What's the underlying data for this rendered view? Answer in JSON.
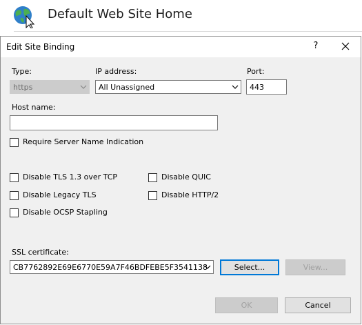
{
  "background": {
    "page_title": "Default Web Site Home"
  },
  "dialog": {
    "title": "Edit Site Binding",
    "help_label": "?",
    "close_label": "×",
    "type": {
      "label": "Type:",
      "value": "https"
    },
    "ip": {
      "label": "IP address:",
      "value": "All Unassigned"
    },
    "port": {
      "label": "Port:",
      "value": "443"
    },
    "host": {
      "label": "Host name:",
      "value": ""
    },
    "sni_label": "Require Server Name Indication",
    "options": {
      "disable_tls13": "Disable TLS 1.3 over TCP",
      "disable_legacy_tls": "Disable Legacy TLS",
      "disable_ocsp": "Disable OCSP Stapling",
      "disable_quic": "Disable QUIC",
      "disable_http2": "Disable HTTP/2"
    },
    "ssl": {
      "label": "SSL certificate:",
      "value": "CB7762892E69E6770E59A7F46BDFEBE5F3541138"
    },
    "buttons": {
      "select": "Select...",
      "view": "View...",
      "ok": "OK",
      "cancel": "Cancel"
    }
  }
}
